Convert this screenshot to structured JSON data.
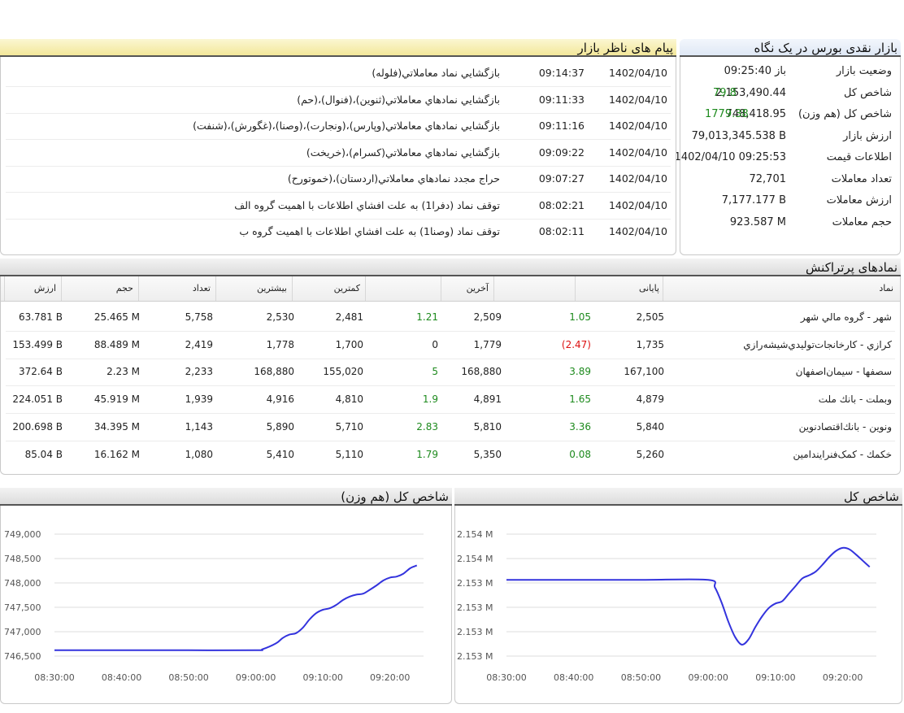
{
  "glance": {
    "title": "بازار نقدی بورس در یک نگاه",
    "rows": [
      {
        "label": "وضعیت بازار",
        "value": "باز 09:25:40",
        "extra": ""
      },
      {
        "label": "شاخص کل",
        "value": "2,153,490.44",
        "extra": "79.8"
      },
      {
        "label": "شاخص کل (هم وزن)",
        "value": "748,418.95",
        "extra": "1779.38"
      },
      {
        "label": "ارزش بازار",
        "value": "79,013,345.538 B",
        "extra": ""
      },
      {
        "label": "اطلاعات قیمت",
        "value": "1402/04/10 09:25:53",
        "extra": ""
      },
      {
        "label": "تعداد معاملات",
        "value": "72,701",
        "extra": ""
      },
      {
        "label": "ارزش معاملات",
        "value": "7,177.177 B",
        "extra": ""
      },
      {
        "label": "حجم معاملات",
        "value": "923.587 M",
        "extra": ""
      }
    ]
  },
  "messages": {
    "title": "پیام های ناظر بازار",
    "rows": [
      {
        "date": "1402/04/10",
        "time": "09:14:37",
        "text": "بازگشايي نماد معاملاتي(فلوله)"
      },
      {
        "date": "1402/04/10",
        "time": "09:11:33",
        "text": "بازگشايي نمادهاي معاملاتي(ثنوین)،(فنوال)،(حم)"
      },
      {
        "date": "1402/04/10",
        "time": "09:11:16",
        "text": "بازگشايي نمادهاي معاملاتي(وپارس)،(ونجارت)،(وصنا)،(غگورش)،(شنفت)"
      },
      {
        "date": "1402/04/10",
        "time": "09:09:22",
        "text": "بازگشايي نمادهاي معاملاتي(کسرام)،(خریخت)"
      },
      {
        "date": "1402/04/10",
        "time": "09:07:27",
        "text": "حراج مجدد نمادهاي معاملاتي(اردستان)،(خموتورح)"
      },
      {
        "date": "1402/04/10",
        "time": "08:02:21",
        "text": "توقف نماد (دفرا1) به علت افشاي اطلاعات با اهمیت گروه الف"
      },
      {
        "date": "1402/04/10",
        "time": "08:02:11",
        "text": "توقف نماد (وصنا1) به علت افشاي اطلاعات با اهمیت گروه ب"
      }
    ]
  },
  "active": {
    "title": "نمادهای پرتراکنش",
    "headers": {
      "symbol": "نماد",
      "close": "پایانی",
      "close_chg": "",
      "last": "آخرین",
      "last_chg": "",
      "low": "کمترین",
      "high": "بیشترین",
      "count": "تعداد",
      "volume": "حجم",
      "value": "ارزش"
    },
    "rows": [
      {
        "symbol": "شهر - گروه مالي شهر",
        "close": "2,505",
        "close_chg": "1.05",
        "close_dir": "up",
        "last": "2,509",
        "last_chg": "1.21",
        "last_dir": "up",
        "low": "2,481",
        "high": "2,530",
        "count": "5,758",
        "volume": "25.465 M",
        "value": "63.781 B"
      },
      {
        "symbol": "کرازي - کارخانجات‌توليدي‌شيشه‌رازي",
        "close": "1,735",
        "close_chg": "(2.47)",
        "close_dir": "down",
        "last": "1,779",
        "last_chg": "0",
        "last_dir": "flat",
        "low": "1,700",
        "high": "1,778",
        "count": "2,419",
        "volume": "88.489 M",
        "value": "153.499 B"
      },
      {
        "symbol": "سصفها - سیمان‌اصفهان",
        "close": "167,100",
        "close_chg": "3.89",
        "close_dir": "up",
        "last": "168,880",
        "last_chg": "5",
        "last_dir": "up",
        "low": "155,020",
        "high": "168,880",
        "count": "2,233",
        "volume": "2.23 M",
        "value": "372.64 B"
      },
      {
        "symbol": "وبملت - بانك ملت",
        "close": "4,879",
        "close_chg": "1.65",
        "close_dir": "up",
        "last": "4,891",
        "last_chg": "1.9",
        "last_dir": "up",
        "low": "4,810",
        "high": "4,916",
        "count": "1,939",
        "volume": "45.919 M",
        "value": "224.051 B"
      },
      {
        "symbol": "ونوین - بانك‌اقتصادنوين",
        "close": "5,840",
        "close_chg": "3.36",
        "close_dir": "up",
        "last": "5,810",
        "last_chg": "2.83",
        "last_dir": "up",
        "low": "5,710",
        "high": "5,890",
        "count": "1,143",
        "volume": "34.395 M",
        "value": "200.698 B"
      },
      {
        "symbol": "خكمك - کمک‌فنرایندامین",
        "close": "5,260",
        "close_chg": "0.08",
        "close_dir": "up",
        "last": "5,350",
        "last_chg": "1.79",
        "last_dir": "up",
        "low": "5,110",
        "high": "5,410",
        "count": "1,080",
        "volume": "16.162 M",
        "value": "85.04 B"
      }
    ]
  },
  "colors": {
    "up": "#1d8a1d",
    "down": "#dd1111",
    "line": "#3333dd",
    "grid": "#dddddd"
  },
  "chart_data": [
    {
      "type": "line",
      "title": "شاخص کل (هم وزن)",
      "xlabel": "",
      "ylabel": "",
      "x_ticks": [
        "08:30:00",
        "08:40:00",
        "08:50:00",
        "09:00:00",
        "09:10:00",
        "09:20:00"
      ],
      "y_ticks": [
        "746,500",
        "747,000",
        "747,500",
        "748,000",
        "748,500",
        "749,000"
      ],
      "ylim": [
        746500,
        749000
      ],
      "xlim": [
        "08:30:00",
        "09:25:00"
      ],
      "grid": true,
      "series": [
        {
          "x": [
            "08:30:00",
            "08:40:00",
            "08:50:00",
            "09:00:00",
            "09:01:00",
            "09:03:00",
            "09:04:00",
            "09:05:00",
            "09:06:00",
            "09:07:00",
            "09:08:00",
            "09:09:00",
            "09:10:00",
            "09:11:00",
            "09:12:00",
            "09:13:00",
            "09:14:00",
            "09:15:00",
            "09:16:00",
            "09:17:00",
            "09:18:00",
            "09:19:00",
            "09:20:00",
            "09:21:00",
            "09:22:00",
            "09:23:00",
            "09:24:00"
          ],
          "y": [
            746620,
            746620,
            746620,
            746620,
            746640,
            746760,
            746870,
            746940,
            746970,
            747080,
            747250,
            747380,
            747450,
            747480,
            747550,
            747650,
            747720,
            747760,
            747780,
            747860,
            747950,
            748050,
            748110,
            748130,
            748190,
            748300,
            748360
          ]
        }
      ]
    },
    {
      "type": "line",
      "title": "شاخص کل",
      "xlabel": "",
      "ylabel": "",
      "x_ticks": [
        "08:30:00",
        "08:40:00",
        "08:50:00",
        "09:00:00",
        "09:10:00",
        "09:20:00"
      ],
      "y_ticks": [
        "2.153 M",
        "2.153 M",
        "2.153 M",
        "2.153 M",
        "2.154 M",
        "2.154 M"
      ],
      "ylim": [
        2152600,
        2154200
      ],
      "xlim": [
        "08:30:00",
        "09:25:00"
      ],
      "grid": true,
      "series": [
        {
          "x": [
            "08:30:00",
            "08:40:00",
            "08:50:00",
            "09:00:00",
            "09:01:00",
            "09:02:00",
            "09:03:00",
            "09:04:00",
            "09:05:00",
            "09:06:00",
            "09:07:00",
            "09:08:00",
            "09:09:00",
            "09:10:00",
            "09:11:00",
            "09:12:00",
            "09:13:00",
            "09:14:00",
            "09:15:00",
            "09:16:00",
            "09:17:00",
            "09:18:00",
            "09:19:00",
            "09:20:00",
            "09:21:00",
            "09:22:00",
            "09:23:00",
            "09:24:00"
          ],
          "y": [
            2153600,
            2153600,
            2153600,
            2153600,
            2153500,
            2153300,
            2153050,
            2152850,
            2152750,
            2152820,
            2152980,
            2153120,
            2153230,
            2153290,
            2153320,
            2153420,
            2153520,
            2153620,
            2153660,
            2153710,
            2153800,
            2153900,
            2153980,
            2154020,
            2154000,
            2153930,
            2153850,
            2153770
          ]
        }
      ]
    }
  ]
}
